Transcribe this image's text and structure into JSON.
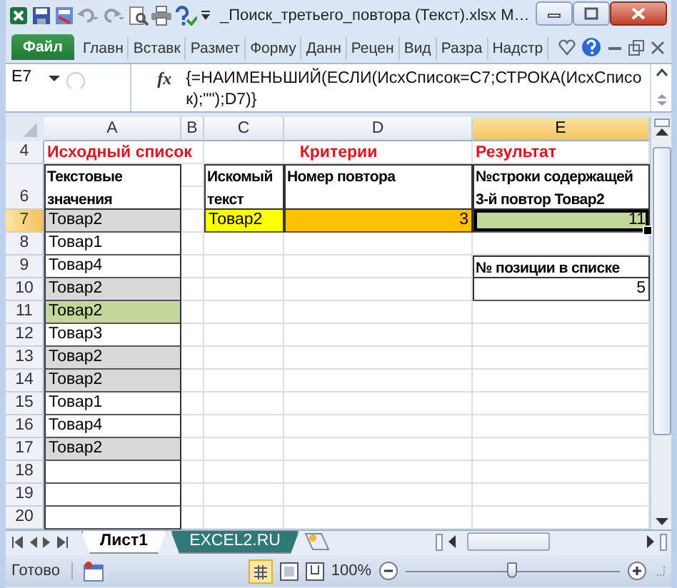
{
  "window": {
    "title": "_Поиск_третьего_повтора (Текст).xlsx M…"
  },
  "ribbon_tabs": [
    {
      "label": "Файл",
      "kind": "file",
      "selected": false
    },
    {
      "label": "Главн",
      "kind": "tab",
      "selected": false
    },
    {
      "label": "Вставк",
      "kind": "tab",
      "selected": false
    },
    {
      "label": "Размет",
      "kind": "tab",
      "selected": false
    },
    {
      "label": "Форму",
      "kind": "tab",
      "selected": false
    },
    {
      "label": "Данн",
      "kind": "tab",
      "selected": false
    },
    {
      "label": "Рецен",
      "kind": "tab",
      "selected": false
    },
    {
      "label": "Вид",
      "kind": "tab",
      "selected": false
    },
    {
      "label": "Разра",
      "kind": "tab",
      "selected": false
    },
    {
      "label": "Надстр",
      "kind": "tab",
      "selected": false
    }
  ],
  "formula_bar": {
    "name_box": "E7",
    "function_button": "fx",
    "formula": "{=НАИМЕНЬШИЙ(ЕСЛИ(ИсхСписок=C7;СТРОКА(ИсхСписок);\"\");D7)}"
  },
  "columns": [
    {
      "label": "A",
      "selected": false
    },
    {
      "label": "B",
      "selected": false
    },
    {
      "label": "C",
      "selected": false
    },
    {
      "label": "D",
      "selected": false
    },
    {
      "label": "E",
      "selected": true
    }
  ],
  "rows": [
    {
      "header": "4",
      "selected": false,
      "A": {
        "text": "Исходный список",
        "kind": "title",
        "selected": false
      },
      "C": {
        "text": "Критерии",
        "kind": "title",
        "selected": false
      },
      "E": {
        "text": "Результат",
        "kind": "title",
        "selected": false
      }
    },
    {
      "header": "6",
      "selected": false,
      "A": {
        "text": "Текстовые значения",
        "kind": "header",
        "selected": false
      },
      "C": {
        "text": "Искомый текст",
        "kind": "header",
        "selected": false
      },
      "D": {
        "text": "Номер повтора",
        "kind": "header",
        "selected": false
      },
      "E": {
        "text": "№строки содержащей 3-й повтор Товар2",
        "kind": "header",
        "selected": false
      }
    },
    {
      "header": "7",
      "selected": true,
      "A": {
        "text": "Товар2",
        "kind": "text",
        "color": "#d9d9d9",
        "selected": false
      },
      "C": {
        "text": "Товар2",
        "kind": "text",
        "color": "#ffff00",
        "selected": false
      },
      "D": {
        "text": "3",
        "kind": "number",
        "color": "#ffc000",
        "selected": false
      },
      "E": {
        "text": "11",
        "kind": "number",
        "color": "#c4d79b",
        "selected": true
      }
    },
    {
      "header": "8",
      "selected": false,
      "A": {
        "text": "Товар1",
        "kind": "text",
        "selected": false
      }
    },
    {
      "header": "9",
      "selected": false,
      "A": {
        "text": "Товар4",
        "kind": "text",
        "selected": false
      },
      "E": {
        "text": "№ позиции в списке",
        "kind": "header",
        "selected": false
      }
    },
    {
      "header": "10",
      "selected": false,
      "A": {
        "text": "Товар2",
        "kind": "text",
        "color": "#d9d9d9",
        "selected": false
      },
      "E": {
        "text": "5",
        "kind": "number",
        "selected": false
      }
    },
    {
      "header": "11",
      "selected": false,
      "A": {
        "text": "Товар2",
        "kind": "text",
        "color": "#c4d79b",
        "selected": false
      }
    },
    {
      "header": "12",
      "selected": false,
      "A": {
        "text": "Товар3",
        "kind": "text",
        "selected": false
      }
    },
    {
      "header": "13",
      "selected": false,
      "A": {
        "text": "Товар2",
        "kind": "text",
        "color": "#d9d9d9",
        "selected": false
      }
    },
    {
      "header": "14",
      "selected": false,
      "A": {
        "text": "Товар2",
        "kind": "text",
        "color": "#d9d9d9",
        "selected": false
      }
    },
    {
      "header": "15",
      "selected": false,
      "A": {
        "text": "Товар1",
        "kind": "text",
        "selected": false
      }
    },
    {
      "header": "16",
      "selected": false,
      "A": {
        "text": "Товар4",
        "kind": "text",
        "selected": false
      }
    },
    {
      "header": "17",
      "selected": false,
      "A": {
        "text": "Товар2",
        "kind": "text",
        "color": "#d9d9d9",
        "selected": false
      }
    },
    {
      "header": "18",
      "selected": false
    },
    {
      "header": "19",
      "selected": false
    },
    {
      "header": "20",
      "selected": false
    }
  ],
  "sheet_tabs": [
    {
      "label": "Лист1",
      "selected": true,
      "color": "#ffffff"
    },
    {
      "label": "EXCEL2.RU",
      "selected": false,
      "color": "#2f7a78"
    }
  ],
  "status_bar": {
    "status": "Готово",
    "zoom": "100%",
    "zoom_slider": {
      "level": 0.5
    }
  }
}
